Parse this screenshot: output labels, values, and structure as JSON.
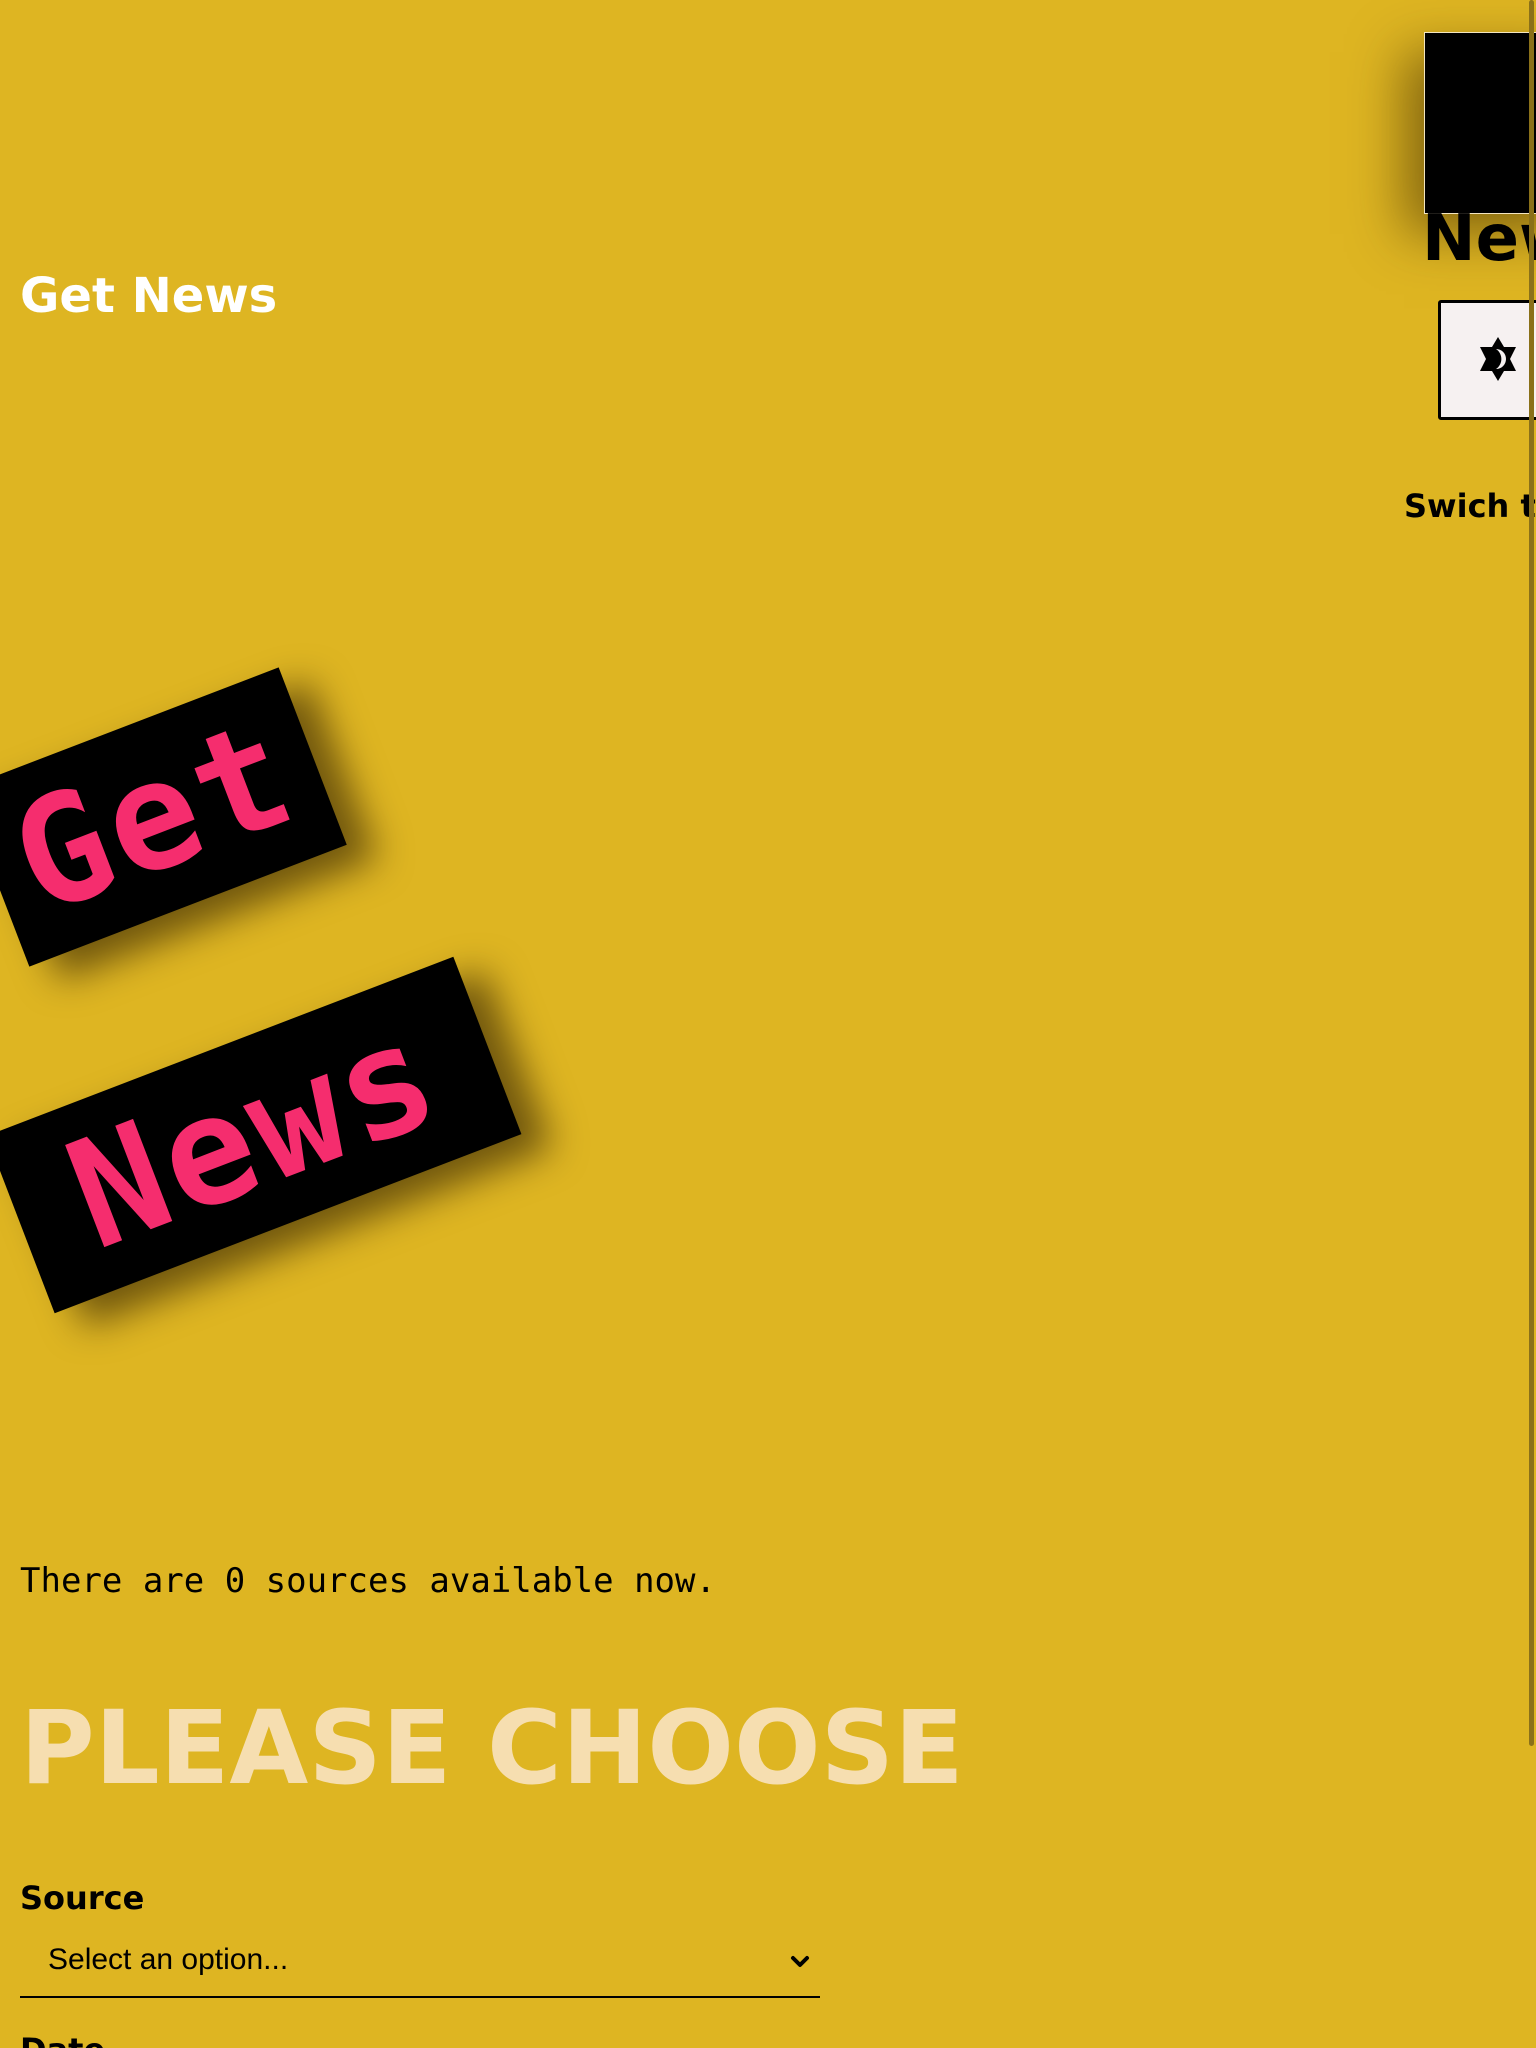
{
  "header": {
    "title": "Get News"
  },
  "widget": {
    "title": "News",
    "theme_button_icon": "theme-toggle-icon",
    "theme_label": "Swich theme"
  },
  "hero": {
    "word1": "Get",
    "word2": "News"
  },
  "main": {
    "sources_text": "There are 0 sources available now.",
    "heading": "PLEASE CHOOSE",
    "source_label": "Source",
    "source_select": {
      "value": "Select an option...",
      "icon": "chevron-down-icon"
    },
    "next_label": "Date"
  },
  "colors": {
    "background": "#deb522",
    "hero_text": "#f52d6e",
    "heading": "#f6deb0",
    "brand_title": "#ffffff"
  }
}
